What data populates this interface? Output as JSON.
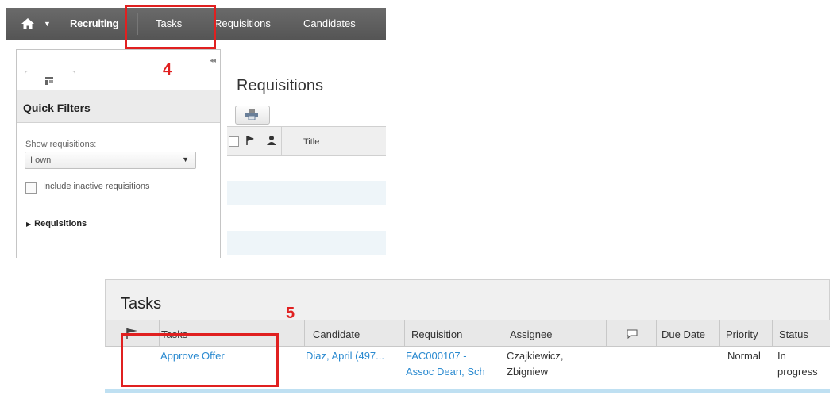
{
  "top_screen": {
    "navbar": {
      "home_caret": "▼",
      "recruiting": "Recruiting",
      "tasks": "Tasks",
      "requisitions": "Requisitions",
      "candidates": "Candidates"
    },
    "left_panel": {
      "collapse_glyph": "◂◂",
      "quick_filters_title": "Quick Filters",
      "show_label": "Show requisitions:",
      "show_value": "I own",
      "select_caret": "▼",
      "inactive_label": "Include inactive requisitions",
      "tree_item": "Requisitions"
    },
    "main": {
      "title": "Requisitions",
      "grid_title_column": "Title"
    },
    "callout": "4"
  },
  "bottom_screen": {
    "title": "Tasks",
    "columns": {
      "tasks": "Tasks",
      "candidate": "Candidate",
      "requisition": "Requisition",
      "assignee": "Assignee",
      "due_date": "Due Date",
      "priority": "Priority",
      "status": "Status"
    },
    "row": {
      "task": "Approve Offer",
      "candidate": "Diaz,  April (497...",
      "requisition_line1": "FAC000107 -",
      "requisition_line2": "Assoc Dean, Sch",
      "assignee_line1": "Czajkiewicz,",
      "assignee_line2": "Zbigniew",
      "priority": "Normal",
      "status_line1": "In",
      "status_line2": "progress"
    },
    "callout": "5"
  },
  "colors": {
    "navbar": "#5f5f5f",
    "link": "#2a8ad0",
    "callout": "#e02020",
    "row_highlight": "#bfe0f2"
  },
  "icons": [
    "home-icon",
    "filter-tab-icon",
    "print-icon",
    "flag-icon",
    "person-icon",
    "comment-icon"
  ]
}
